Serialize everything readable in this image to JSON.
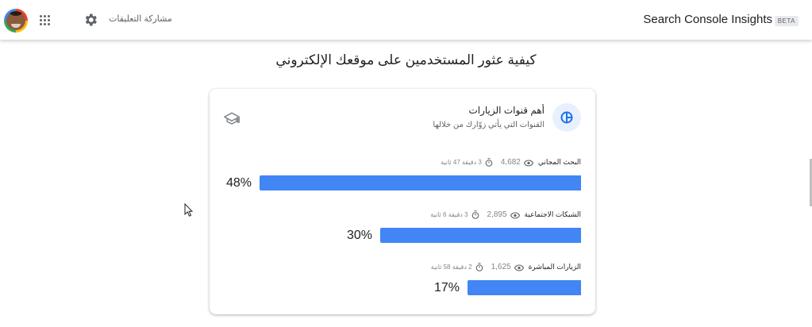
{
  "header": {
    "app_title": "Search Console Insights",
    "beta_badge": "BETA",
    "feedback_label": "مشاركة التعليقات",
    "icons": [
      "avatar",
      "apps-grid-icon",
      "gear-icon"
    ]
  },
  "page": {
    "title": "كيفية عثور المستخدمين على موقعك الإلكتروني"
  },
  "card": {
    "title": "أهم قنوات الزيارات",
    "subtitle": "القنوات التي يأتي زوّارك من خلالها",
    "icon": "pie-chart-icon",
    "learn_icon": "school-icon",
    "channels": [
      {
        "name": "البحث المجاني",
        "users": "4,682",
        "duration": "3 دقيقة 47 ثانية",
        "percent_label": "48%",
        "percent": 48
      },
      {
        "name": "الشبكات الاجتماعية",
        "users": "2,895",
        "duration": "3 دقيقة 6 ثانية",
        "percent_label": "30%",
        "percent": 30
      },
      {
        "name": "الزيارات المباشرة",
        "users": "1,625",
        "duration": "2 دقيقة 58 ثانية",
        "percent_label": "17%",
        "percent": 17
      }
    ]
  },
  "colors": {
    "bar": "#4285f4",
    "accent": "#1a73e8"
  }
}
